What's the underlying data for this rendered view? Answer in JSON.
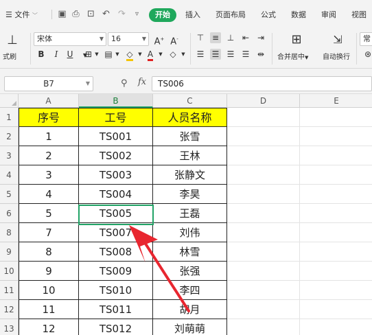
{
  "menu": {
    "file_label": "文件",
    "tabs": [
      "开始",
      "插入",
      "页面布局",
      "公式",
      "数据",
      "审阅",
      "视图"
    ]
  },
  "ribbon": {
    "format_painter_label": "式刷",
    "font_name": "宋体",
    "font_size": "16",
    "merge_center_label": "合并居中",
    "wrap_text_label": "自动换行",
    "number_format": "常",
    "bold_label": "B",
    "italic_label": "I",
    "underline_label": "U"
  },
  "formula_bar": {
    "name_box": "B7",
    "fx_label": "fx",
    "formula": "TS006"
  },
  "sheet": {
    "columns": [
      "A",
      "B",
      "C",
      "D",
      "E"
    ],
    "selected_column": "B",
    "header_row_label": "1",
    "header_cells": [
      "序号",
      "工号",
      "人员名称"
    ],
    "rows": [
      {
        "row": "2",
        "a": "1",
        "b": "TS001",
        "c": "张雪"
      },
      {
        "row": "3",
        "a": "2",
        "b": "TS002",
        "c": "王林"
      },
      {
        "row": "4",
        "a": "3",
        "b": "TS003",
        "c": "张静文"
      },
      {
        "row": "5",
        "a": "4",
        "b": "TS004",
        "c": "李昊"
      },
      {
        "row": "6",
        "a": "5",
        "b": "TS005",
        "c": "王磊"
      },
      {
        "row": "8",
        "a": "7",
        "b": "TS007",
        "c": "刘伟"
      },
      {
        "row": "9",
        "a": "8",
        "b": "TS008",
        "c": "林雪"
      },
      {
        "row": "10",
        "a": "9",
        "b": "TS009",
        "c": "张强"
      },
      {
        "row": "11",
        "a": "10",
        "b": "TS010",
        "c": "李四"
      },
      {
        "row": "12",
        "a": "11",
        "b": "TS011",
        "c": "胡月"
      },
      {
        "row": "13",
        "a": "12",
        "b": "TS012",
        "c": "刘萌萌"
      }
    ],
    "header_fill_color": "#ffff00",
    "selection_color": "#21a366",
    "arrow_color": "#e8262f"
  }
}
